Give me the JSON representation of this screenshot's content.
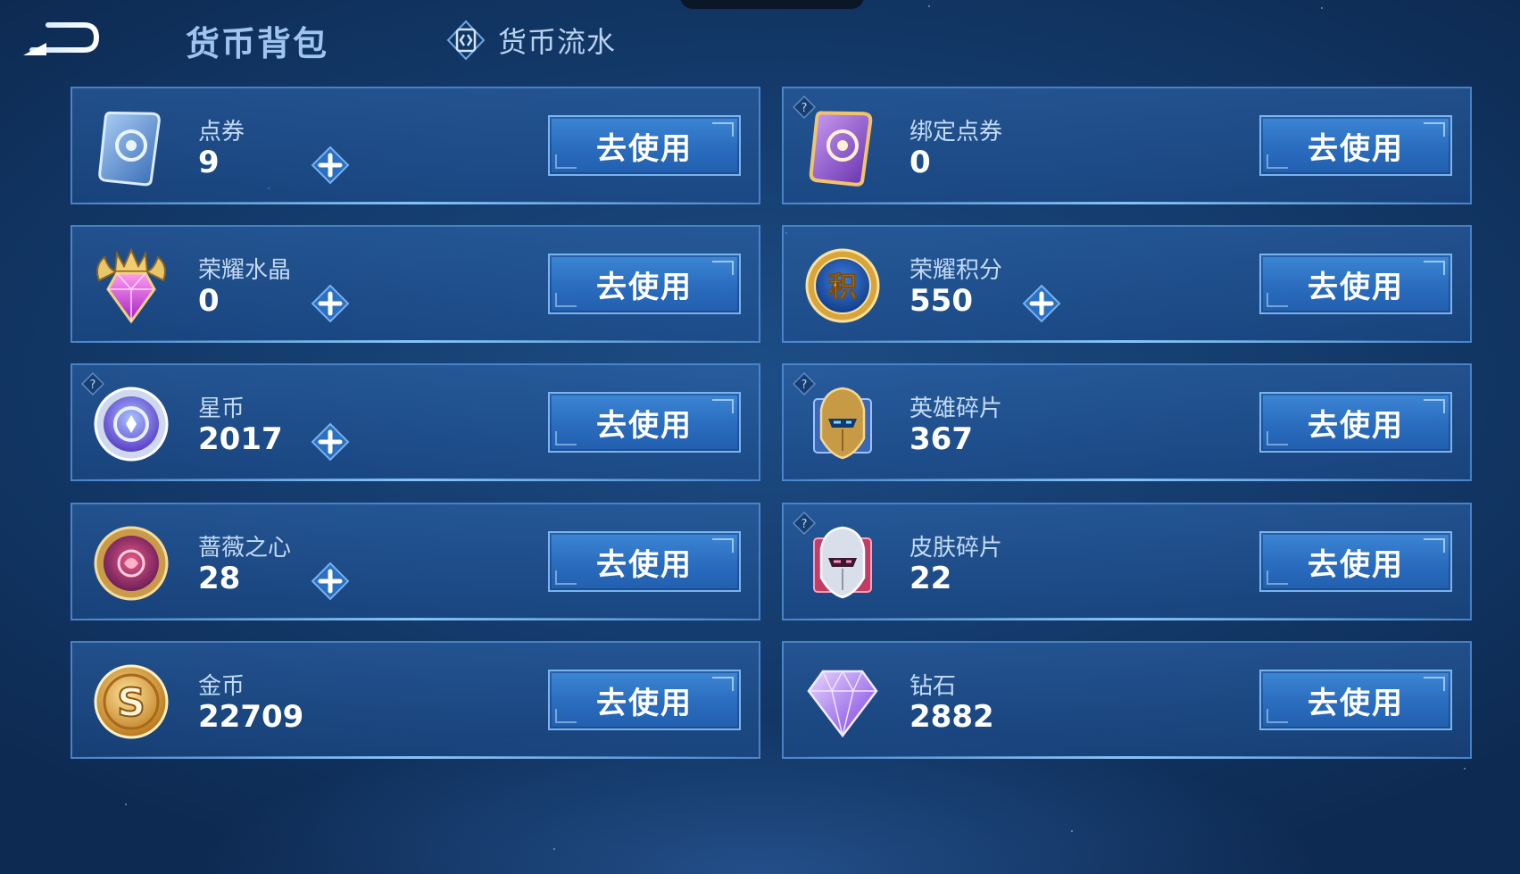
{
  "header": {
    "title": "货币背包",
    "history_label": "货币流水"
  },
  "use_label": "去使用",
  "currencies": [
    {
      "name": "点券",
      "value": "9",
      "icon": "coupon-icon",
      "plus": true,
      "help": false
    },
    {
      "name": "绑定点券",
      "value": "0",
      "icon": "bound-coupon-icon",
      "plus": false,
      "help": true
    },
    {
      "name": "荣耀水晶",
      "value": "0",
      "icon": "glory-crystal-icon",
      "plus": true,
      "help": false
    },
    {
      "name": "荣耀积分",
      "value": "550",
      "icon": "glory-points-icon",
      "plus": true,
      "help": false
    },
    {
      "name": "星币",
      "value": "2017",
      "icon": "star-coin-icon",
      "plus": true,
      "help": true
    },
    {
      "name": "英雄碎片",
      "value": "367",
      "icon": "hero-fragment-icon",
      "plus": false,
      "help": true
    },
    {
      "name": "蔷薇之心",
      "value": "28",
      "icon": "rose-heart-icon",
      "plus": true,
      "help": false
    },
    {
      "name": "皮肤碎片",
      "value": "22",
      "icon": "skin-fragment-icon",
      "plus": false,
      "help": true
    },
    {
      "name": "金币",
      "value": "22709",
      "icon": "gold-coin-icon",
      "plus": false,
      "help": false
    },
    {
      "name": "钻石",
      "value": "2882",
      "icon": "diamond-icon",
      "plus": false,
      "help": false
    }
  ],
  "points_icon_glyph": "积",
  "colors": {
    "accent": "#2a6cbe",
    "card_border": "#5896de",
    "title": "#9ec4ef"
  }
}
